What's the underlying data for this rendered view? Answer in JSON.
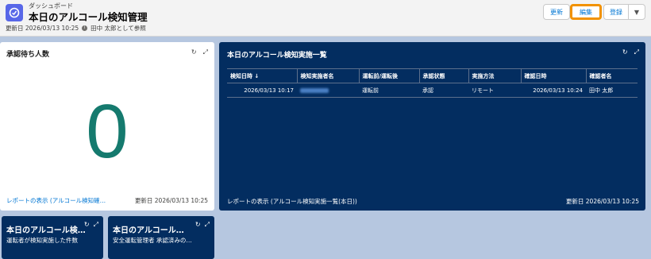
{
  "header": {
    "breadcrumb": "ダッシュボード",
    "title": "本日のアルコール検知管理",
    "updated": "更新日 2026/03/13 10:25",
    "viewing_as": "田中 太郎として参照",
    "buttons": {
      "refresh": "更新",
      "edit": "編集",
      "register": "登録",
      "menu": "▼"
    }
  },
  "left_card": {
    "title": "承認待ち人数",
    "value": "0",
    "report_link": "レポートの表示 (アルコール検知確認…",
    "updated": "更新日 2026/03/13 10:25",
    "tools": {
      "refresh": "↻",
      "expand": "⤢"
    }
  },
  "right_card": {
    "title": "本日のアルコール検知実施一覧",
    "columns": [
      "検知日時 ↓",
      "検知実施者名",
      "運転前/運転後",
      "承認状態",
      "実施方法",
      "確認日時",
      "確認者名"
    ],
    "rows": [
      {
        "detected_at": "2026/03/13 10:17",
        "driving": "運転前",
        "status": "承認",
        "method": "リモート",
        "confirmed_at": "2026/03/13 10:24",
        "confirmer": "田中 太郎"
      }
    ],
    "report_link": "レポートの表示 (アルコール検知実施一覧(本日))",
    "updated": "更新日 2026/03/13 10:25",
    "tools": {
      "refresh": "↻",
      "expand": "⤢"
    }
  },
  "mini_cards": [
    {
      "title": "本日のアルコール検知…",
      "subtitle": "運転者が検知実施した件数",
      "tools": {
        "refresh": "↻",
        "expand": "⤢"
      }
    },
    {
      "title": "本日のアルコール…",
      "subtitle": "安全運転管理者 承認済みの…",
      "tools": {
        "refresh": "↻",
        "expand": "⤢"
      }
    }
  ],
  "colors": {
    "accent": "#0176d3",
    "dark_card": "#032d60",
    "metric": "#157a6e",
    "highlight": "#f29200",
    "background": "#b6c7e0"
  }
}
